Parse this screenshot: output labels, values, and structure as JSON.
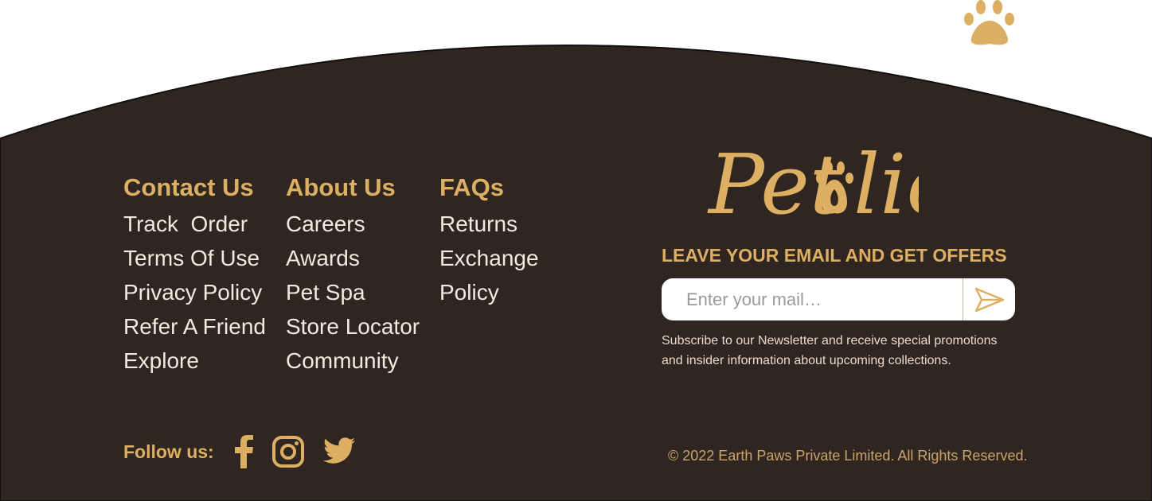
{
  "colors": {
    "footer_background": "#302621",
    "accent_gold": "#dcaf62",
    "link_text": "#f3e9dd",
    "page_background": "#ffffff"
  },
  "decorations": {
    "top_paw_icon": "paw-icon"
  },
  "columns": [
    {
      "heading": "Contact Us",
      "links": [
        "Track  Order",
        "Terms Of Use",
        "Privacy Policy",
        "Refer A Friend",
        "Explore"
      ]
    },
    {
      "heading": "About Us",
      "links": [
        "Careers",
        "Awards",
        "Pet Spa",
        "Store Locator",
        "Community"
      ]
    },
    {
      "heading": "FAQs",
      "links": [
        "Returns",
        "Exchange",
        "Policy"
      ]
    }
  ],
  "brand": {
    "logo_text_before": "Pet",
    "logo_text_after": "lic",
    "logo_icon": "paw-icon"
  },
  "newsletter": {
    "heading": "LEAVE YOUR EMAIL AND GET OFFERS",
    "placeholder": "Enter your mail…",
    "value": "",
    "submit_icon": "send-icon",
    "note": "Subscribe to our Newsletter and receive special promotions and insider information about upcoming collections."
  },
  "social": {
    "label": "Follow us:",
    "icons": [
      "facebook-icon",
      "instagram-icon",
      "twitter-icon"
    ]
  },
  "copyright": "© 2022 Earth Paws Private Limited. All Rights Reserved."
}
